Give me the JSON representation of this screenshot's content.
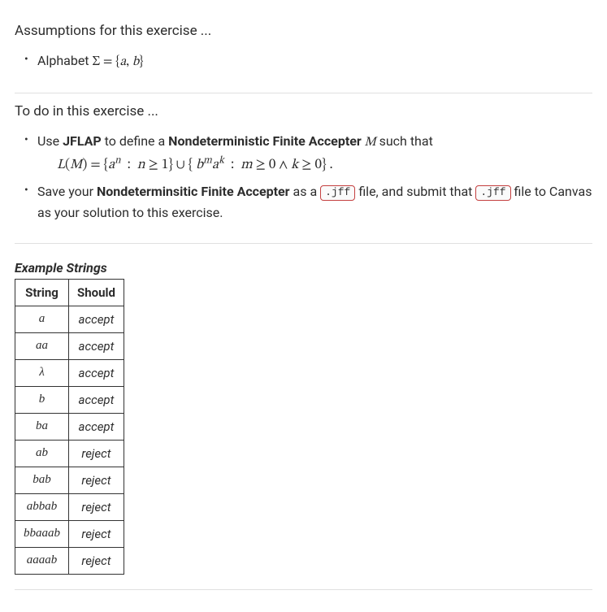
{
  "assumptions": {
    "title": "Assumptions for this exercise ...",
    "alphabet_prefix": "Alphabet ",
    "alphabet_expr": "Σ = {a, b}"
  },
  "todo": {
    "title": "To do in this exercise ...",
    "item1_pre": "Use ",
    "item1_jflap": "JFLAP",
    "item1_mid": " to define a ",
    "item1_nfa": "Nondeterministic Finite Accepter",
    "item1_M": " M ",
    "item1_post": "such that",
    "lang_expr": "L(M) = {aⁿ  :  n ≥ 1} ∪ { bᵐaᵏ  :  m ≥ 0 ∧ k ≥ 0} .",
    "item2_pre": "Save your ",
    "item2_nfa": "Nondeterminsitic Finite Accepter",
    "item2_mid1": " as a ",
    "jff_ext": ".jff",
    "item2_mid2": " file, and submit that ",
    "item2_post": " file to Canvas as your solution to this exercise."
  },
  "examples": {
    "caption": "Example Strings",
    "col1": "String",
    "col2": "Should",
    "rows": [
      {
        "string": "a",
        "result": "accept"
      },
      {
        "string": "aa",
        "result": "accept"
      },
      {
        "string": "λ",
        "result": "accept"
      },
      {
        "string": "b",
        "result": "accept"
      },
      {
        "string": "ba",
        "result": "accept"
      },
      {
        "string": "ab",
        "result": "reject"
      },
      {
        "string": "bab",
        "result": "reject"
      },
      {
        "string": "abbab",
        "result": "reject"
      },
      {
        "string": "bbaaab",
        "result": "reject"
      },
      {
        "string": "aaaab",
        "result": "reject"
      }
    ]
  }
}
